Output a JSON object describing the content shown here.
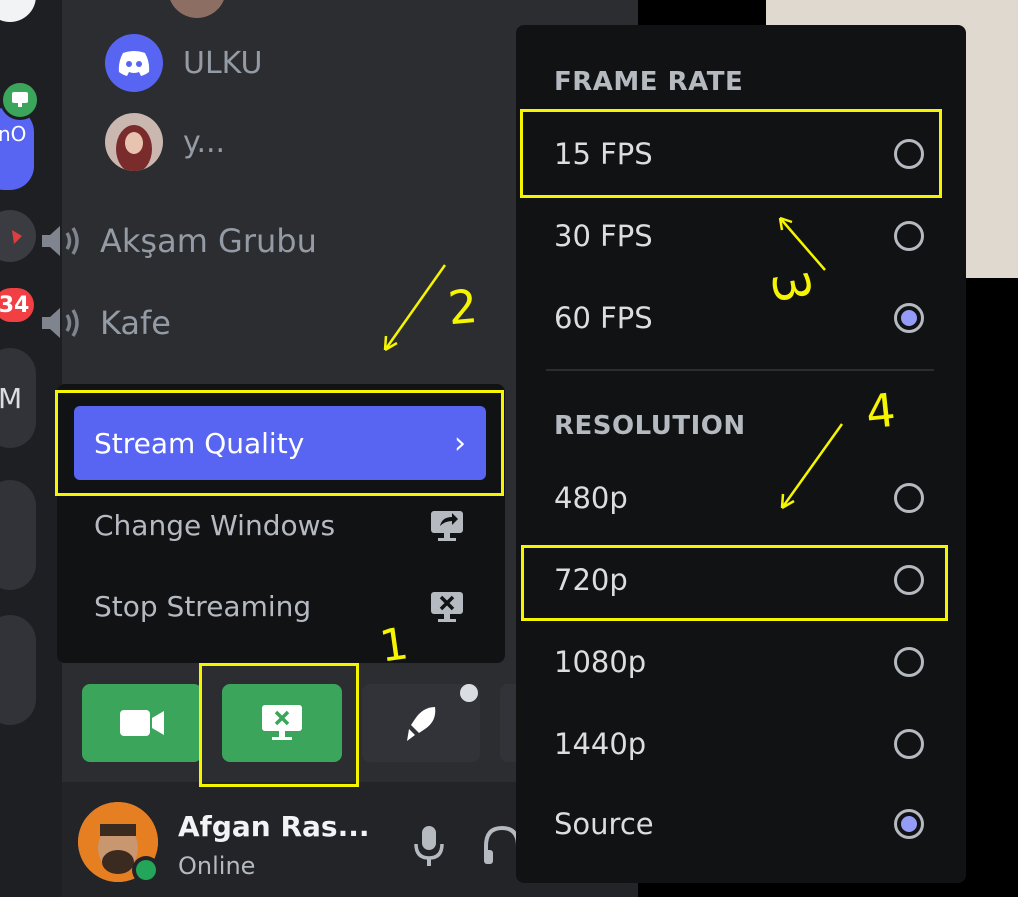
{
  "server_rail": {
    "badge_count": "34",
    "partial_labels": [
      "nO",
      "M"
    ]
  },
  "voice": {
    "members": [
      {
        "name": "ULKU",
        "avatar": "discord-logo-icon"
      },
      {
        "name": "y..."
      }
    ],
    "channels": [
      "Akşam Grubu",
      "Kafe"
    ]
  },
  "context_menu": {
    "items": [
      {
        "label": "Stream Quality",
        "icon": "chevron-right-icon",
        "active": true
      },
      {
        "label": "Change Windows",
        "icon": "screen-switch-icon"
      },
      {
        "label": "Stop Streaming",
        "icon": "screen-close-icon"
      }
    ]
  },
  "action_bar": {
    "buttons": [
      "camera-icon",
      "screen-share-icon",
      "activities-rocket-icon"
    ]
  },
  "user_panel": {
    "username": "Afgan Ras...",
    "status": "Online",
    "status_color": "#23a55a"
  },
  "submenu": {
    "frame_rate": {
      "heading": "FRAME RATE",
      "options": [
        {
          "label": "15 FPS",
          "selected": false
        },
        {
          "label": "30 FPS",
          "selected": false
        },
        {
          "label": "60 FPS",
          "selected": true
        }
      ]
    },
    "resolution": {
      "heading": "RESOLUTION",
      "options": [
        {
          "label": "480p",
          "selected": false
        },
        {
          "label": "720p",
          "selected": false
        },
        {
          "label": "1080p",
          "selected": false
        },
        {
          "label": "1440p",
          "selected": false
        },
        {
          "label": "Source",
          "selected": true
        }
      ]
    }
  },
  "annotations": {
    "step_numbers": [
      "1",
      "2",
      "3",
      "4"
    ],
    "highlight_color": "#f5f500"
  },
  "colors": {
    "accent": "#5865f2",
    "green": "#3ba55c",
    "radio_selected": "#949cf7"
  }
}
